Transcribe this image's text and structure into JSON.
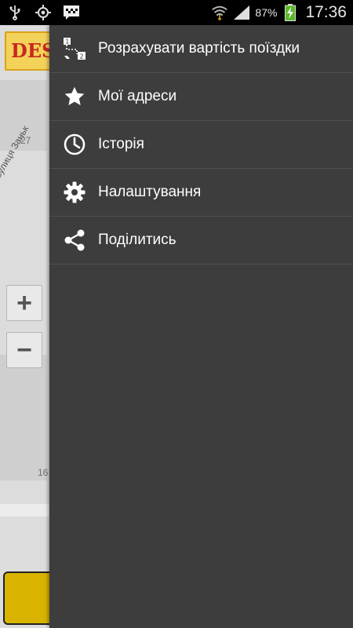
{
  "status_bar": {
    "battery_percent": "87%",
    "time": "17:36",
    "icons": [
      "usb-icon",
      "gps-icon",
      "notification-app-icon",
      "wifi-icon",
      "signal-icon",
      "battery-charging-icon"
    ]
  },
  "map": {
    "logo_text": "DES",
    "street_name": "вулиця Заньк",
    "numbers": [
      "27",
      "16"
    ],
    "zoom_in_label": "+",
    "zoom_out_label": "−"
  },
  "drawer": {
    "items": [
      {
        "label": "Розрахувати вартість поїздки",
        "icon": "route-icon"
      },
      {
        "label": "Мої адреси",
        "icon": "star-icon"
      },
      {
        "label": "Історія",
        "icon": "clock-icon"
      },
      {
        "label": "Налаштування",
        "icon": "gear-icon"
      },
      {
        "label": "Поділитись",
        "icon": "share-icon"
      }
    ]
  }
}
